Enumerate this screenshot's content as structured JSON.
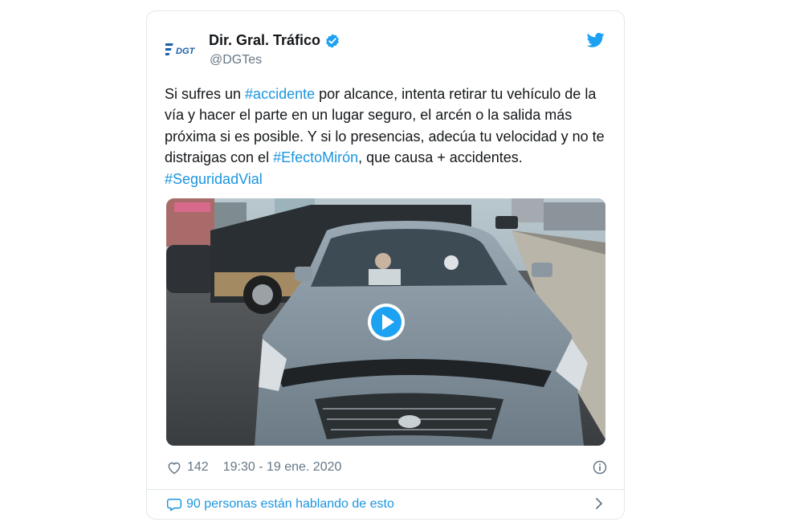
{
  "tweet": {
    "author_name": "Dir. Gral. Tráfico",
    "handle": "@DGTes",
    "logo_text": "DGT",
    "text": {
      "t1": "Si sufres un ",
      "h1": "#accidente",
      "t2": " por alcance, intenta retirar tu vehículo de la vía y hacer el parte en un lugar seguro, el arcén o la salida más próxima si es posible. Y si lo presencias, adecúa tu velocidad y no te distraigas con el ",
      "h2": "#EfectoMirón",
      "t3": ", que causa + accidentes. ",
      "h3": "#SeguridadVial"
    },
    "likes": "142",
    "timestamp": "19:30 - 19 ene. 2020",
    "conversation": "90 personas están hablando de esto"
  },
  "colors": {
    "link": "#1b95e0",
    "text": "#14171a",
    "muted": "#657786",
    "border": "#e1e8ed"
  },
  "icons": [
    "dgt-logo",
    "verified-icon",
    "twitter-bird-icon",
    "play-icon",
    "heart-icon",
    "info-icon",
    "comment-bubble-icon",
    "chevron-right-icon"
  ]
}
